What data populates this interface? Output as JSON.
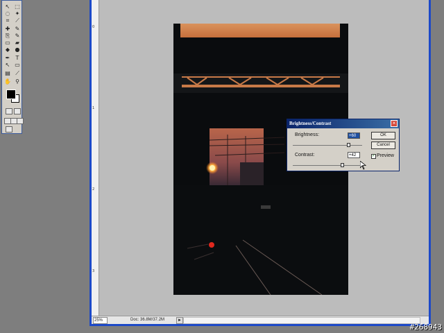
{
  "toolbox": {
    "tools": [
      "move",
      "marquee",
      "lasso",
      "magic-wand",
      "crop",
      "slice",
      "healing",
      "brush",
      "clone",
      "history",
      "eraser",
      "gradient",
      "blur",
      "dodge",
      "pen",
      "type",
      "path-select",
      "shape",
      "notes",
      "eyedropper",
      "hand",
      "zoom"
    ],
    "glyphs": [
      "↖",
      "⬚",
      "◌",
      "✦",
      "⌗",
      "⟋",
      "✚",
      "✎",
      "⎘",
      "✎",
      "▭",
      "▰",
      "◆",
      "●",
      "✒",
      "T",
      "↖",
      "▭",
      "▤",
      "⟋",
      "✋",
      "⚲"
    ],
    "foreground_color": "#000000",
    "background_color": "#ffffff"
  },
  "document": {
    "ruler_numbers": [
      "0",
      "1",
      "2",
      "3"
    ],
    "zoom": "25%",
    "doc_size": "Doc: 36.8M/37.2M",
    "status_arrow": "►"
  },
  "dialog": {
    "title": "Brightness/Contrast",
    "close": "×",
    "brightness_label": "Brightness:",
    "brightness_value": "+60",
    "contrast_label": "Contrast:",
    "contrast_value": "+42",
    "ok_label": "OK",
    "cancel_label": "Cancel",
    "preview_label": "Preview",
    "preview_checked": true,
    "checkmark": "✓"
  },
  "image_id": "#268943"
}
